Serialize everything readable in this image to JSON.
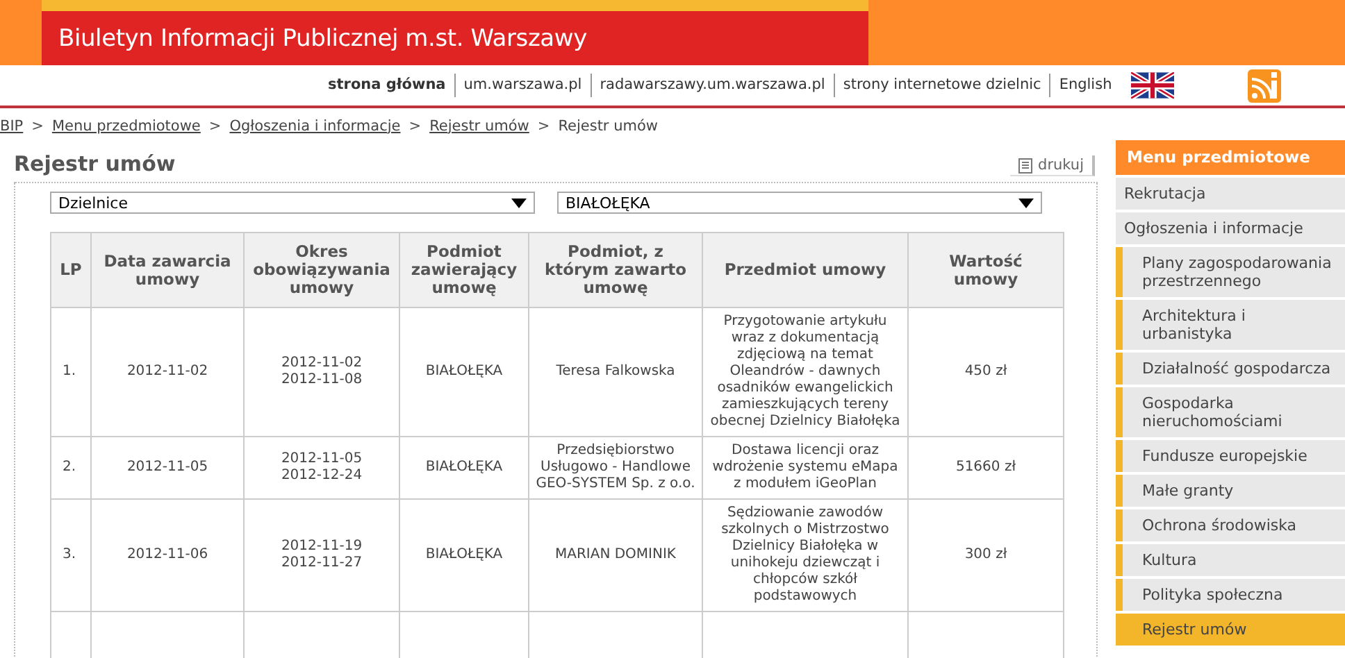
{
  "header": {
    "title": "Biuletyn Informacji Publicznej m.st. Warszawy"
  },
  "top_links": [
    {
      "label": "strona główna",
      "bold": true
    },
    {
      "label": "um.warszawa.pl",
      "bold": false
    },
    {
      "label": "radawarszawy.um.warszawa.pl",
      "bold": false
    },
    {
      "label": "strony internetowe dzielnic",
      "bold": false
    },
    {
      "label": "English",
      "bold": false
    }
  ],
  "breadcrumb": [
    {
      "label": "BIP",
      "link": true
    },
    {
      "label": "Menu przedmiotowe",
      "link": true
    },
    {
      "label": "Ogłoszenia i informacje",
      "link": true
    },
    {
      "label": "Rejestr umów",
      "link": true
    },
    {
      "label": "Rejestr umów",
      "link": false
    }
  ],
  "breadcrumb_separator": ">",
  "page_title": "Rejestr umów",
  "print_label": "drukuj",
  "filters": [
    {
      "value": "Dzielnice"
    },
    {
      "value": "BIAŁOŁĘKA"
    }
  ],
  "table": {
    "columns": [
      "LP",
      "Data zawarcia umowy",
      "Okres obowiązywania umowy",
      "Podmiot zawierający umowę",
      "Podmiot, z którym zawarto umowę",
      "Przedmiot umowy",
      "Wartość umowy"
    ],
    "rows": [
      [
        "1.",
        "2012-11-02",
        "2012-11-02\n2012-11-08",
        "BIAŁOŁĘKA",
        "Teresa Falkowska",
        "Przygotowanie artykułu wraz z dokumentacją zdjęciową na temat Oleandrów - dawnych osadników ewangelickich zamieszkujących tereny obecnej Dzielnicy Białołęka",
        "450 zł"
      ],
      [
        "2.",
        "2012-11-05",
        "2012-11-05\n2012-12-24",
        "BIAŁOŁĘKA",
        "Przedsiębiorstwo Usługowo - Handlowe GEO-SYSTEM Sp. z o.o.",
        "Dostawa licencji oraz wdrożenie systemu eMapa z modułem iGeoPlan",
        "51660 zł"
      ],
      [
        "3.",
        "2012-11-06",
        "2012-11-19\n2012-11-27",
        "BIAŁOŁĘKA",
        "MARIAN DOMINIK",
        "Sędziowanie zawodów szkolnych o Mistrzostwo Dzielnicy Białołęka w unihokeju dziewcząt i chłopców szkół podstawowych",
        "300 zł"
      ]
    ]
  },
  "sidebar": {
    "title": "Menu przedmiotowe",
    "items": [
      {
        "label": "Rekrutacja",
        "selected": false
      },
      {
        "label": "Ogłoszenia i informacje",
        "selected": false,
        "children": [
          {
            "label": "Plany zagospodarowania przestrzennego",
            "selected": false
          },
          {
            "label": "Architektura i urbanistyka",
            "selected": false
          },
          {
            "label": "Działalność gospodarcza",
            "selected": false
          },
          {
            "label": "Gospodarka nieruchomościami",
            "selected": false
          },
          {
            "label": "Fundusze europejskie",
            "selected": false
          },
          {
            "label": "Małe granty",
            "selected": false
          },
          {
            "label": "Ochrona środowiska",
            "selected": false
          },
          {
            "label": "Kultura",
            "selected": false
          },
          {
            "label": "Polityka społeczna",
            "selected": false
          },
          {
            "label": "Rejestr umów",
            "selected": true
          }
        ]
      }
    ]
  }
}
